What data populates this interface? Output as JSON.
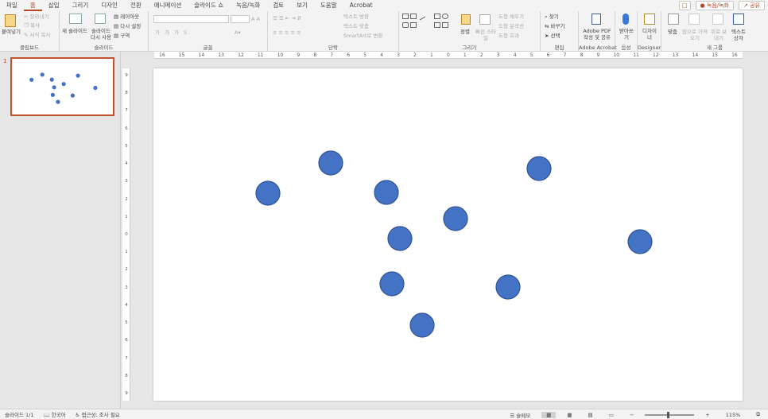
{
  "menubar": {
    "items": [
      "파일",
      "홈",
      "삽입",
      "그리기",
      "디자인",
      "전환",
      "애니메이션",
      "슬라이드 쇼",
      "녹음/녹화",
      "검토",
      "보기",
      "도움말",
      "Acrobat"
    ],
    "active_index": 1,
    "record_label": "녹음/녹화",
    "share_label": "공유"
  },
  "ribbon": {
    "clipboard": {
      "paste": "붙여넣기",
      "cut": "잘라내기",
      "copy": "복사",
      "format_painter": "서식 복사",
      "label": "클립보드"
    },
    "slides": {
      "new_slide": "새 슬라이드",
      "reuse": "슬라이드 다시 사용",
      "layout": "레이아웃",
      "reset": "다시 설정",
      "section": "구역",
      "label": "슬라이드"
    },
    "font": {
      "label": "글꼴",
      "bold": "가",
      "italic": "가",
      "underline": "가",
      "strike": "S"
    },
    "paragraph": {
      "text_direction": "텍스트 방향",
      "align_text": "텍스트 맞춤",
      "smartart": "SmartArt로 변환",
      "label": "단락"
    },
    "drawing": {
      "arrange": "정렬",
      "quick_styles": "빠른 스타일",
      "fill": "도형 채우기",
      "outline": "도형 윤곽선",
      "effects": "도형 효과",
      "label": "그리기"
    },
    "editing": {
      "find": "찾기",
      "replace": "바꾸기",
      "select": "선택",
      "label": "편집"
    },
    "acrobat": {
      "create": "Adobe PDF 작성 및 공유",
      "label": "Adobe Acrobat"
    },
    "voice": {
      "dictate": "받아쓰기",
      "label": "음성"
    },
    "designer": {
      "ideas": "디자이너",
      "label": "Designer"
    },
    "newgroup": {
      "group": "맞춤",
      "text_box": "텍스트 상자",
      "label": "새 그룹",
      "ir1": "임으로 가져오기",
      "ir2": "위로 보내기"
    }
  },
  "ruler": {
    "h_ticks": [
      "16",
      "15",
      "14",
      "13",
      "12",
      "11",
      "10",
      "9",
      "8",
      "7",
      "6",
      "5",
      "4",
      "3",
      "2",
      "1",
      "0",
      "1",
      "2",
      "3",
      "4",
      "5",
      "6",
      "7",
      "8",
      "9",
      "10",
      "11",
      "12",
      "13",
      "14",
      "15",
      "16"
    ],
    "v_ticks": [
      "9",
      "8",
      "7",
      "6",
      "5",
      "4",
      "3",
      "2",
      "1",
      "0",
      "1",
      "2",
      "3",
      "4",
      "5",
      "6",
      "7",
      "8",
      "9"
    ]
  },
  "thumbpane": {
    "slide_number": "1"
  },
  "slide": {
    "circle_color": "#4472c4",
    "circle_stroke": "#2f5597"
  },
  "statusbar": {
    "slide_info": "슬라이드 1/1",
    "language": "한국어",
    "accessibility": "접근성: 조사 필요",
    "notes": "슬메모",
    "zoom": "115%"
  }
}
